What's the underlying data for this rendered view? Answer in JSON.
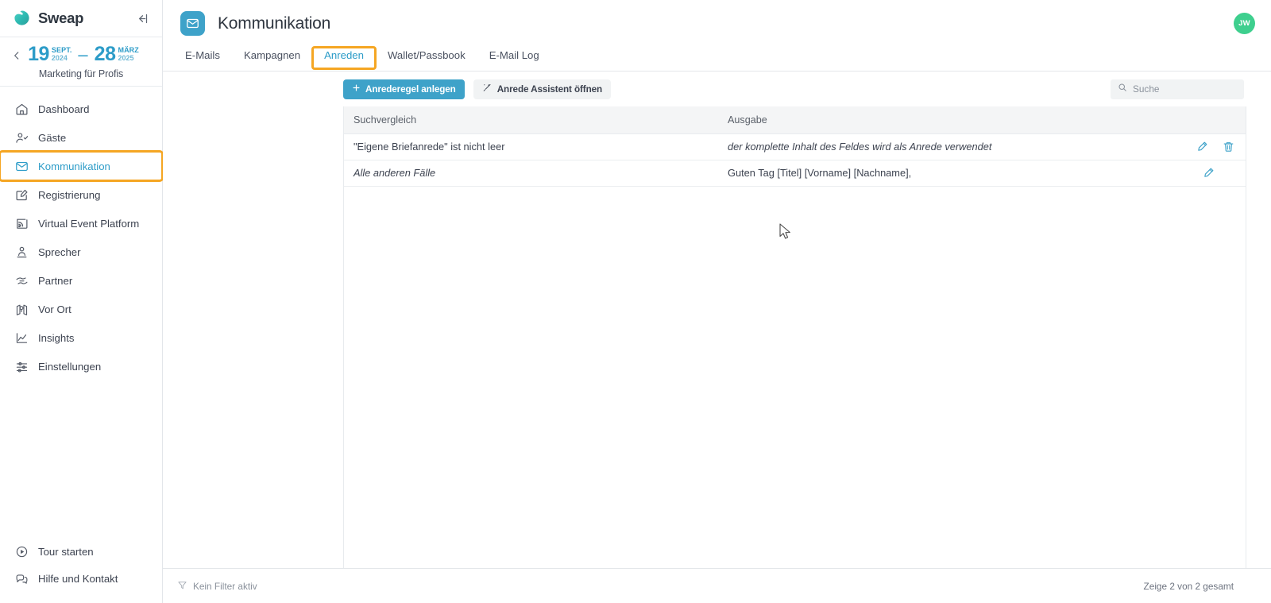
{
  "brand": {
    "name": "Sweap",
    "logo_icon": "sweap-logo-icon",
    "collapse_icon": "collapse-sidebar-icon"
  },
  "event": {
    "prev_icon": "chevron-left-icon",
    "start_day": "19",
    "start_month": "SEPT.",
    "start_year": "2024",
    "dash": "–",
    "end_day": "28",
    "end_month": "MÄRZ",
    "end_year": "2025",
    "name": "Marketing für Profis"
  },
  "sidebar": {
    "items": [
      {
        "label": "Dashboard",
        "icon": "home-icon"
      },
      {
        "label": "Gäste",
        "icon": "user-check-icon"
      },
      {
        "label": "Kommunikation",
        "icon": "envelope-icon"
      },
      {
        "label": "Registrierung",
        "icon": "form-edit-icon"
      },
      {
        "label": "Virtual Event Platform",
        "icon": "broadcast-icon"
      },
      {
        "label": "Sprecher",
        "icon": "speaker-person-icon"
      },
      {
        "label": "Partner",
        "icon": "handshake-icon"
      },
      {
        "label": "Vor Ort",
        "icon": "map-pin-icon"
      },
      {
        "label": "Insights",
        "icon": "chart-line-icon"
      },
      {
        "label": "Einstellungen",
        "icon": "sliders-icon"
      }
    ],
    "bottom_items": [
      {
        "label": "Tour starten",
        "icon": "play-circle-icon"
      },
      {
        "label": "Hilfe und Kontakt",
        "icon": "chat-bubbles-icon"
      }
    ]
  },
  "header": {
    "title": "Kommunikation",
    "icon": "envelope-icon",
    "avatar_initials": "JW"
  },
  "tabs": [
    {
      "label": "E-Mails"
    },
    {
      "label": "Kampagnen"
    },
    {
      "label": "Anreden"
    },
    {
      "label": "Wallet/Passbook"
    },
    {
      "label": "E-Mail Log"
    }
  ],
  "toolbar": {
    "create_rule_label": "Anrederegel anlegen",
    "create_rule_icon": "plus-icon",
    "assistant_label": "Anrede Assistent öffnen",
    "assistant_icon": "magic-wand-icon",
    "search_placeholder": "Suche",
    "search_value": "",
    "search_icon": "search-icon"
  },
  "table": {
    "columns": [
      "Suchvergleich",
      "Ausgabe",
      ""
    ],
    "rows": [
      {
        "match": "\"Eigene Briefanrede\" ist nicht leer",
        "match_italic": false,
        "output": "der komplette Inhalt des Feldes wird als Anrede verwendet",
        "output_italic": true,
        "edit_icon": "pencil-icon",
        "delete_icon": "trash-icon",
        "has_delete": true
      },
      {
        "match": "Alle anderen Fälle",
        "match_italic": true,
        "output": "Guten Tag [Titel] [Vorname] [Nachname],",
        "output_italic": false,
        "edit_icon": "pencil-icon",
        "delete_icon": "",
        "has_delete": false
      }
    ]
  },
  "footer": {
    "filter_label": "Kein Filter aktiv",
    "filter_icon": "funnel-icon",
    "count_label": "Zeige 2 von 2 gesamt"
  },
  "colors": {
    "accent_blue": "#3ea2c9",
    "link_blue": "#2d9cc8",
    "highlight_orange": "#f5a623",
    "avatar_green": "#3ecf8e",
    "header_grey": "#f4f5f6"
  }
}
